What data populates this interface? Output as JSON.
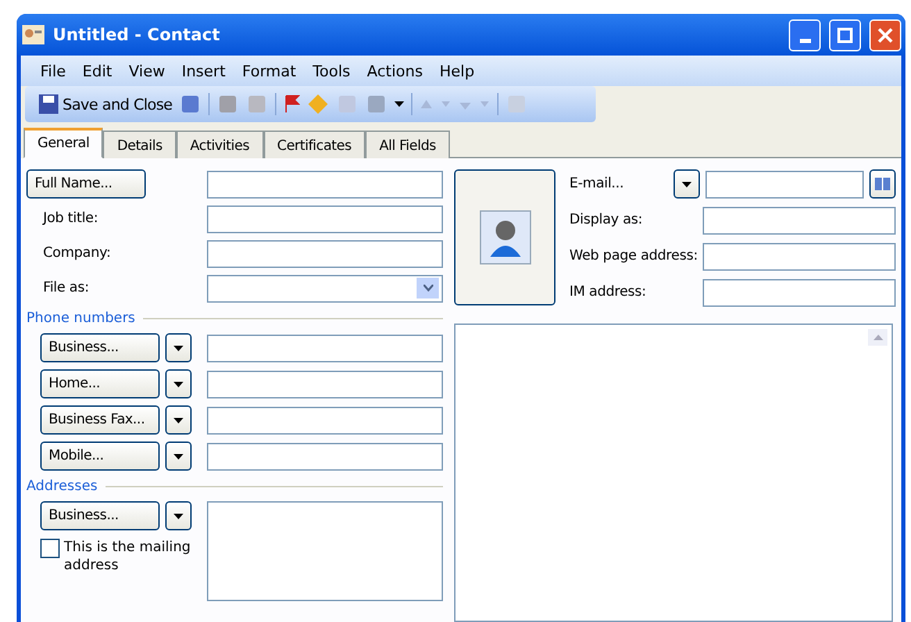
{
  "window": {
    "title": "Untitled - Contact"
  },
  "menu": [
    "File",
    "Edit",
    "View",
    "Insert",
    "Format",
    "Tools",
    "Actions",
    "Help"
  ],
  "toolbar": {
    "save_close": "Save and Close"
  },
  "tabs": [
    {
      "label": "General",
      "selected": true
    },
    {
      "label": "Details",
      "selected": false
    },
    {
      "label": "Activities",
      "selected": false
    },
    {
      "label": "Certificates",
      "selected": false
    },
    {
      "label": "All Fields",
      "selected": false
    }
  ],
  "name_button": "Full Name...",
  "fields": [
    {
      "label": "Job title:",
      "kind": "text"
    },
    {
      "label": "Company:",
      "kind": "text"
    },
    {
      "label": "File as:",
      "kind": "combo"
    }
  ],
  "phone_section": "Phone numbers",
  "phones": [
    "Business...",
    "Home...",
    "Business Fax...",
    "Mobile..."
  ],
  "address_section": "Addresses",
  "address_button": "Business...",
  "mailing": {
    "label": "This is the mailing address",
    "checked": false
  },
  "email_button": "E-mail...",
  "right_fields": [
    "Display as:",
    "Web page address:",
    "IM address:"
  ]
}
